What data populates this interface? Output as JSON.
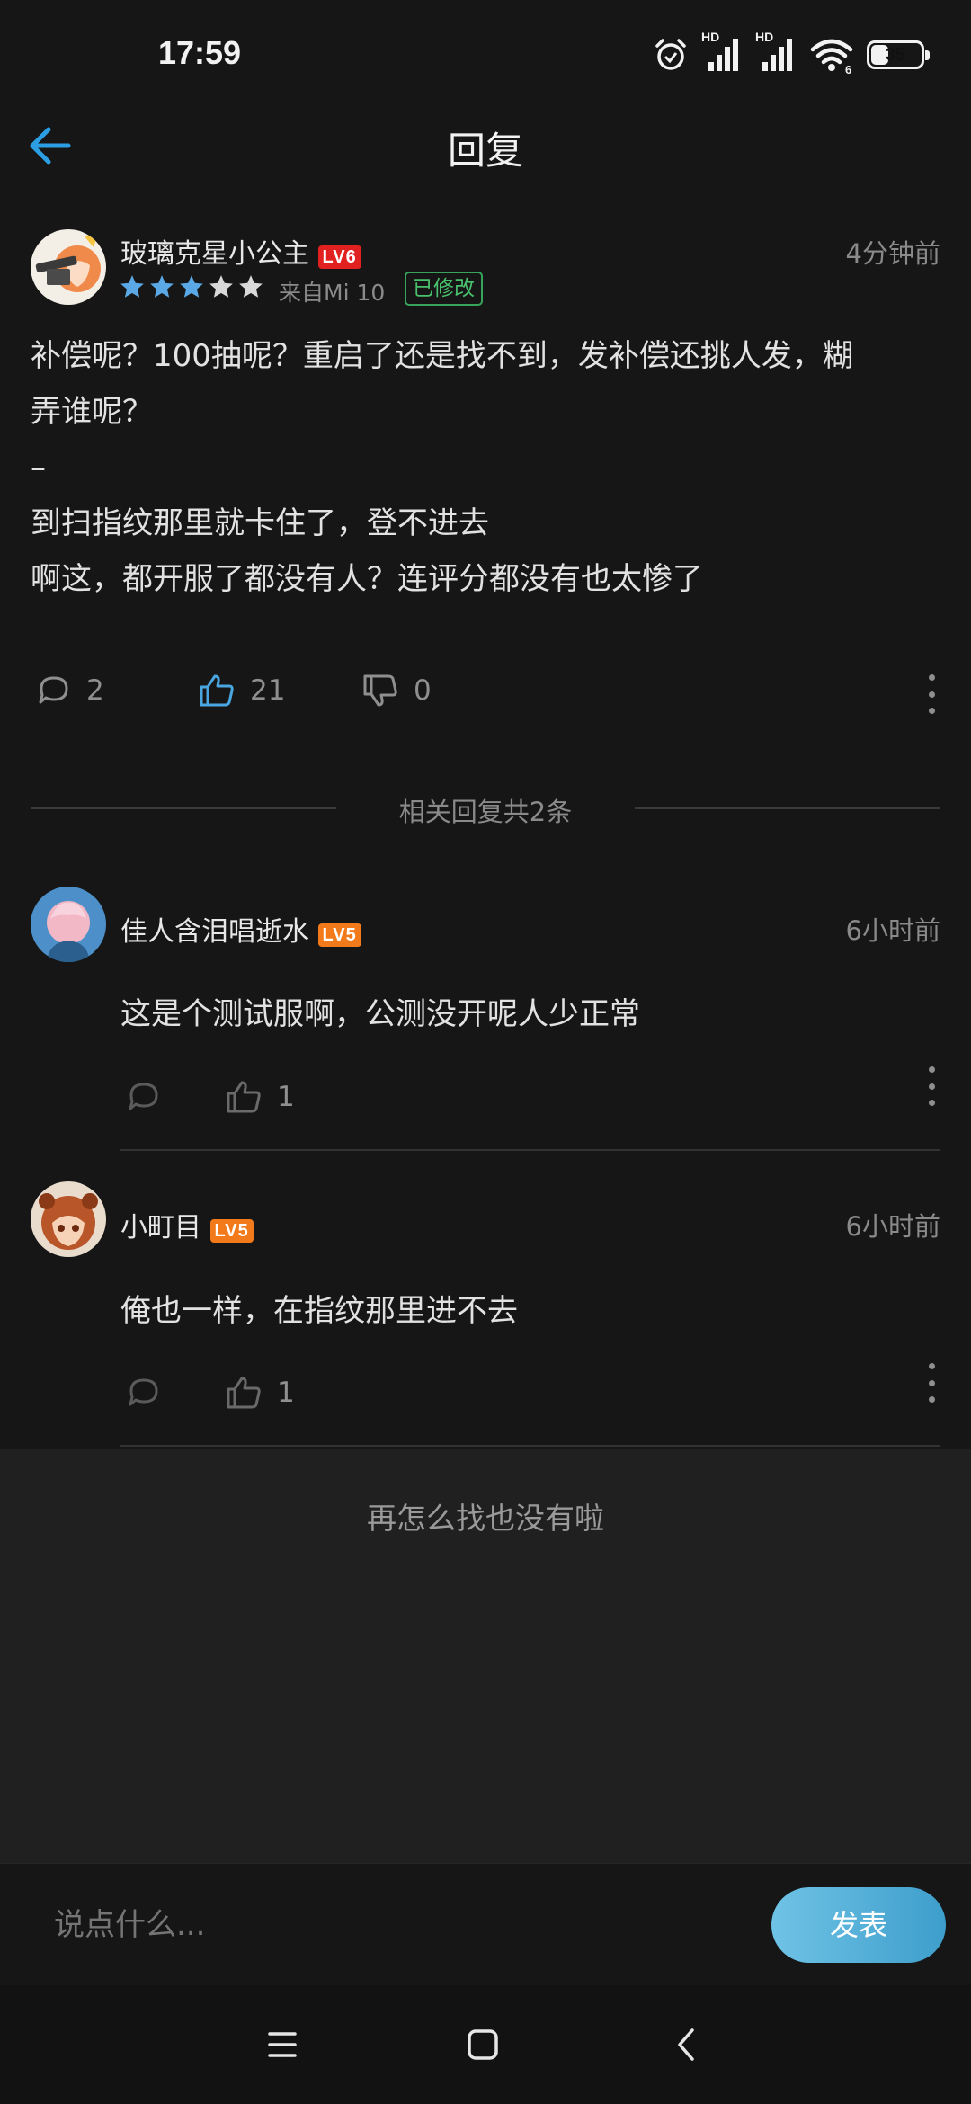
{
  "status": {
    "time": "17:59",
    "hd1": "HD",
    "hd2": "HD",
    "wifi_badge": "6",
    "battery": "35",
    "battery_level": 0.35
  },
  "header": {
    "title": "回复",
    "back_icon": "arrow-left-icon",
    "accent": "#2c9fe4"
  },
  "main_comment": {
    "username": "玻璃克星小公主",
    "level": "LV6",
    "time": "4分钟前",
    "rating": 3,
    "rating_max": 5,
    "device": "来自Mi 10",
    "edited_badge": "已修改",
    "content_lines": [
      "补偿呢？100抽呢？重启了还是找不到，发补偿还挑人发，糊",
      "弄谁呢？",
      "–",
      "到扫指纹那里就卡住了，登不进去",
      "啊这，都开服了都没有人？连评分都没有也太惨了"
    ],
    "reply_count": "2",
    "like_count": "21",
    "dislike_count": "0"
  },
  "section": {
    "label": "相关回复共2条"
  },
  "replies": [
    {
      "username": "佳人含泪唱逝水",
      "level": "LV5",
      "time": "6小时前",
      "text": "这是个测试服啊，公测没开呢人少正常",
      "like_count": "1"
    },
    {
      "username": "小町目",
      "level": "LV5",
      "time": "6小时前",
      "text": "俺也一样，在指纹那里进不去",
      "like_count": "1"
    }
  ],
  "end_text": "再怎么找也没有啦",
  "composer": {
    "placeholder": "说点什么...",
    "post_label": "发表"
  },
  "colors": {
    "background": "#161616",
    "star_filled": "#5aa9e6",
    "star_empty": "#d9d9d9",
    "level_red": "#e12020",
    "level_orange": "#f37a1b",
    "edited": "#49c06c"
  }
}
